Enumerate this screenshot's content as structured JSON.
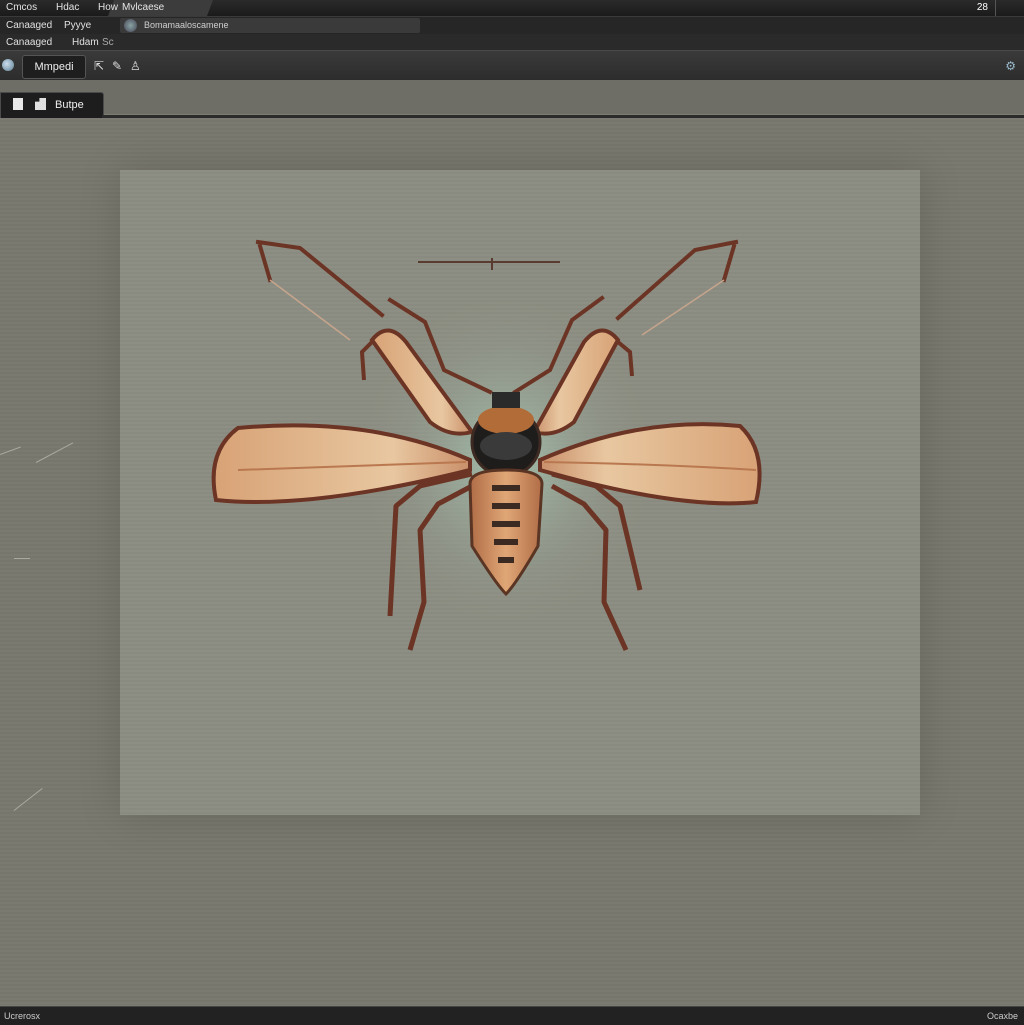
{
  "menubar": {
    "items": [
      "Cmcos",
      "Hdac",
      "How"
    ],
    "selected": "Pyyye",
    "selected_extra": "Mvlcaese",
    "right": "28"
  },
  "addressbar": {
    "label1": "Canaaged",
    "label2": "Hdam",
    "label3": "Sc",
    "field_text": "Bomamaaloscamene"
  },
  "toolbar": {
    "tab_label": "Mmpedi",
    "icons": [
      "pointer-icon",
      "brush-icon",
      "bucket-icon"
    ]
  },
  "document_tab": {
    "label": "Butpe"
  },
  "canvas": {
    "subject": "pixel-art winged insect"
  },
  "status": {
    "left": "Ucrerosx",
    "right": "Ocaxbe"
  },
  "colors": {
    "menubar": "#1e1e1e",
    "workspace": "#7a7a70",
    "canvas": "#8e8f84",
    "wing": "#d9a27a",
    "leg": "#6b3424"
  }
}
